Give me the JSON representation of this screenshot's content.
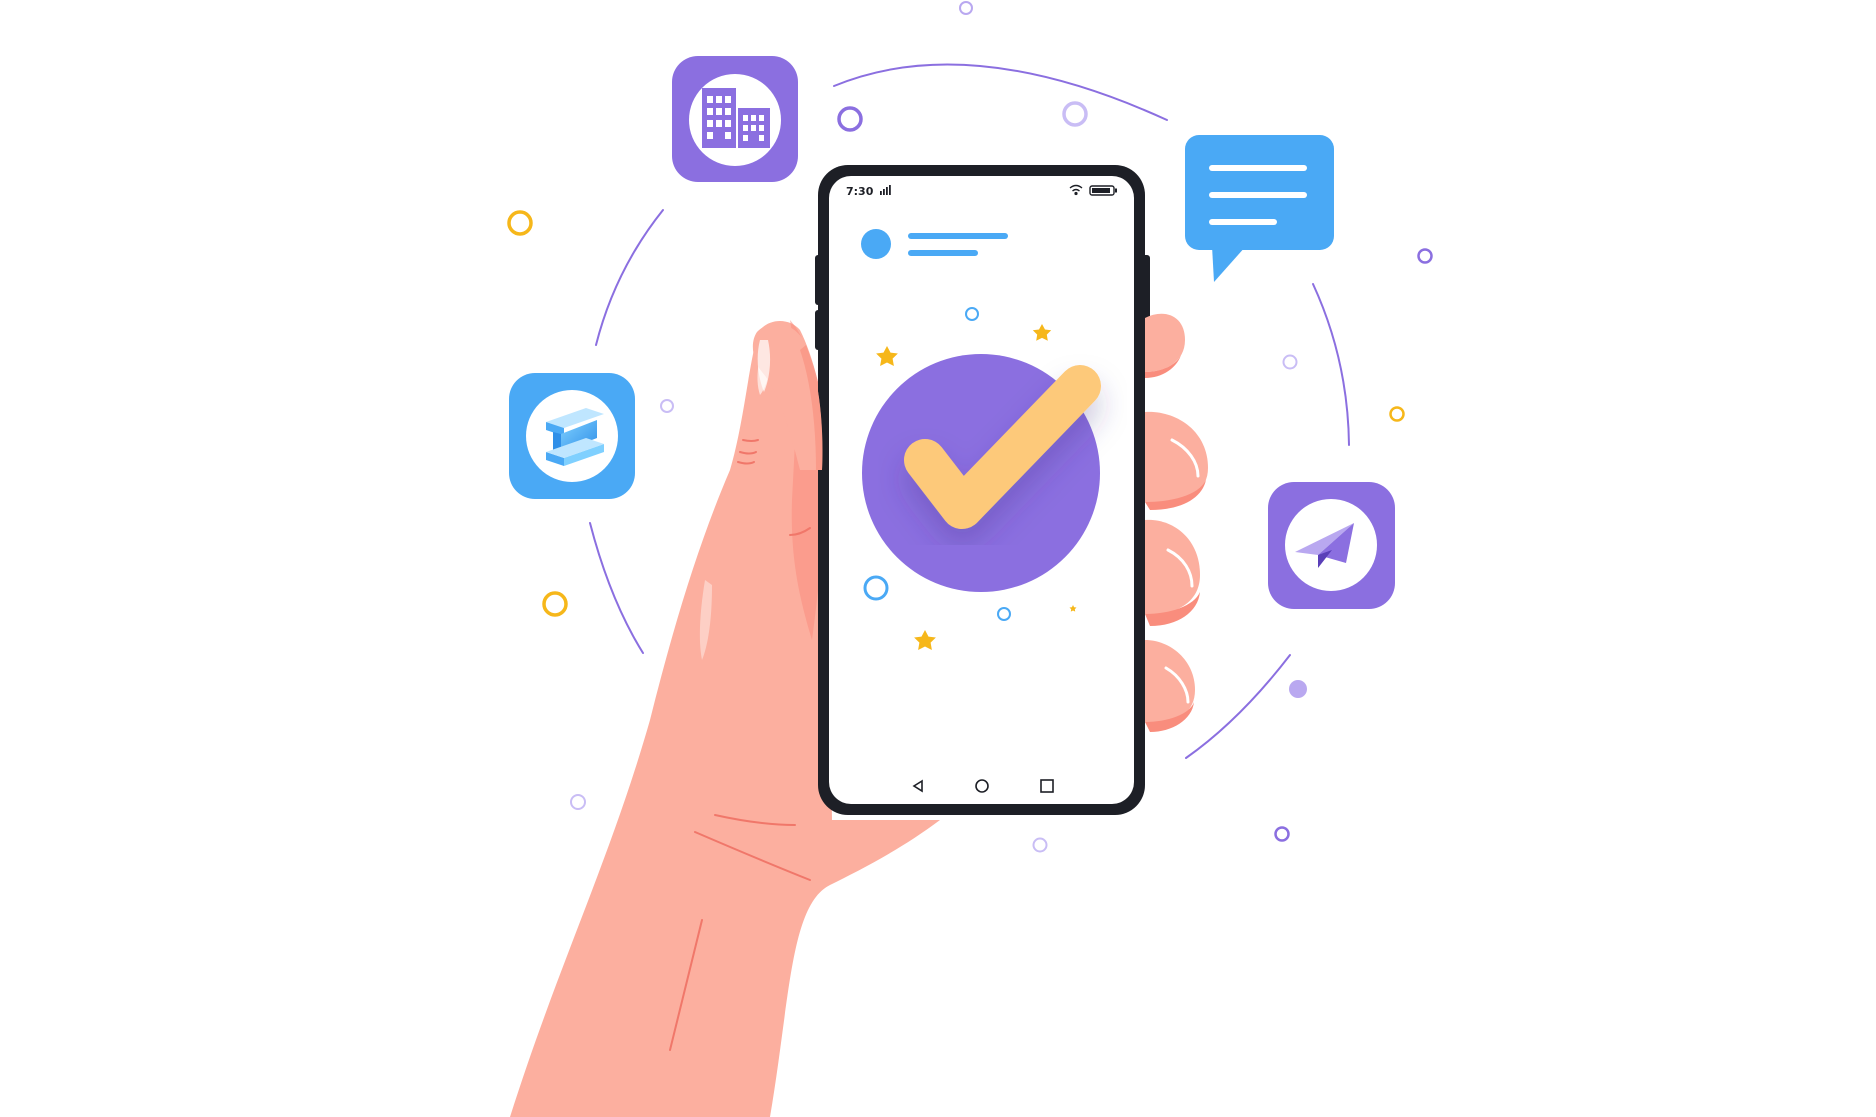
{
  "phone": {
    "status_time": "7:30"
  },
  "icons": {
    "building": "building-app-icon",
    "steel_beam": "steel-beam-app-icon",
    "chat": "chat-bubble-icon",
    "send": "paper-plane-app-icon",
    "checkmark": "checkmark-badge-icon"
  },
  "colors": {
    "purple": "#8b6fe0",
    "blue": "#4aa9f5",
    "yellow": "#f6b71a",
    "check": "#fdc97a",
    "skin": "#fcaf9f",
    "phone_frame": "#1d1f26"
  }
}
